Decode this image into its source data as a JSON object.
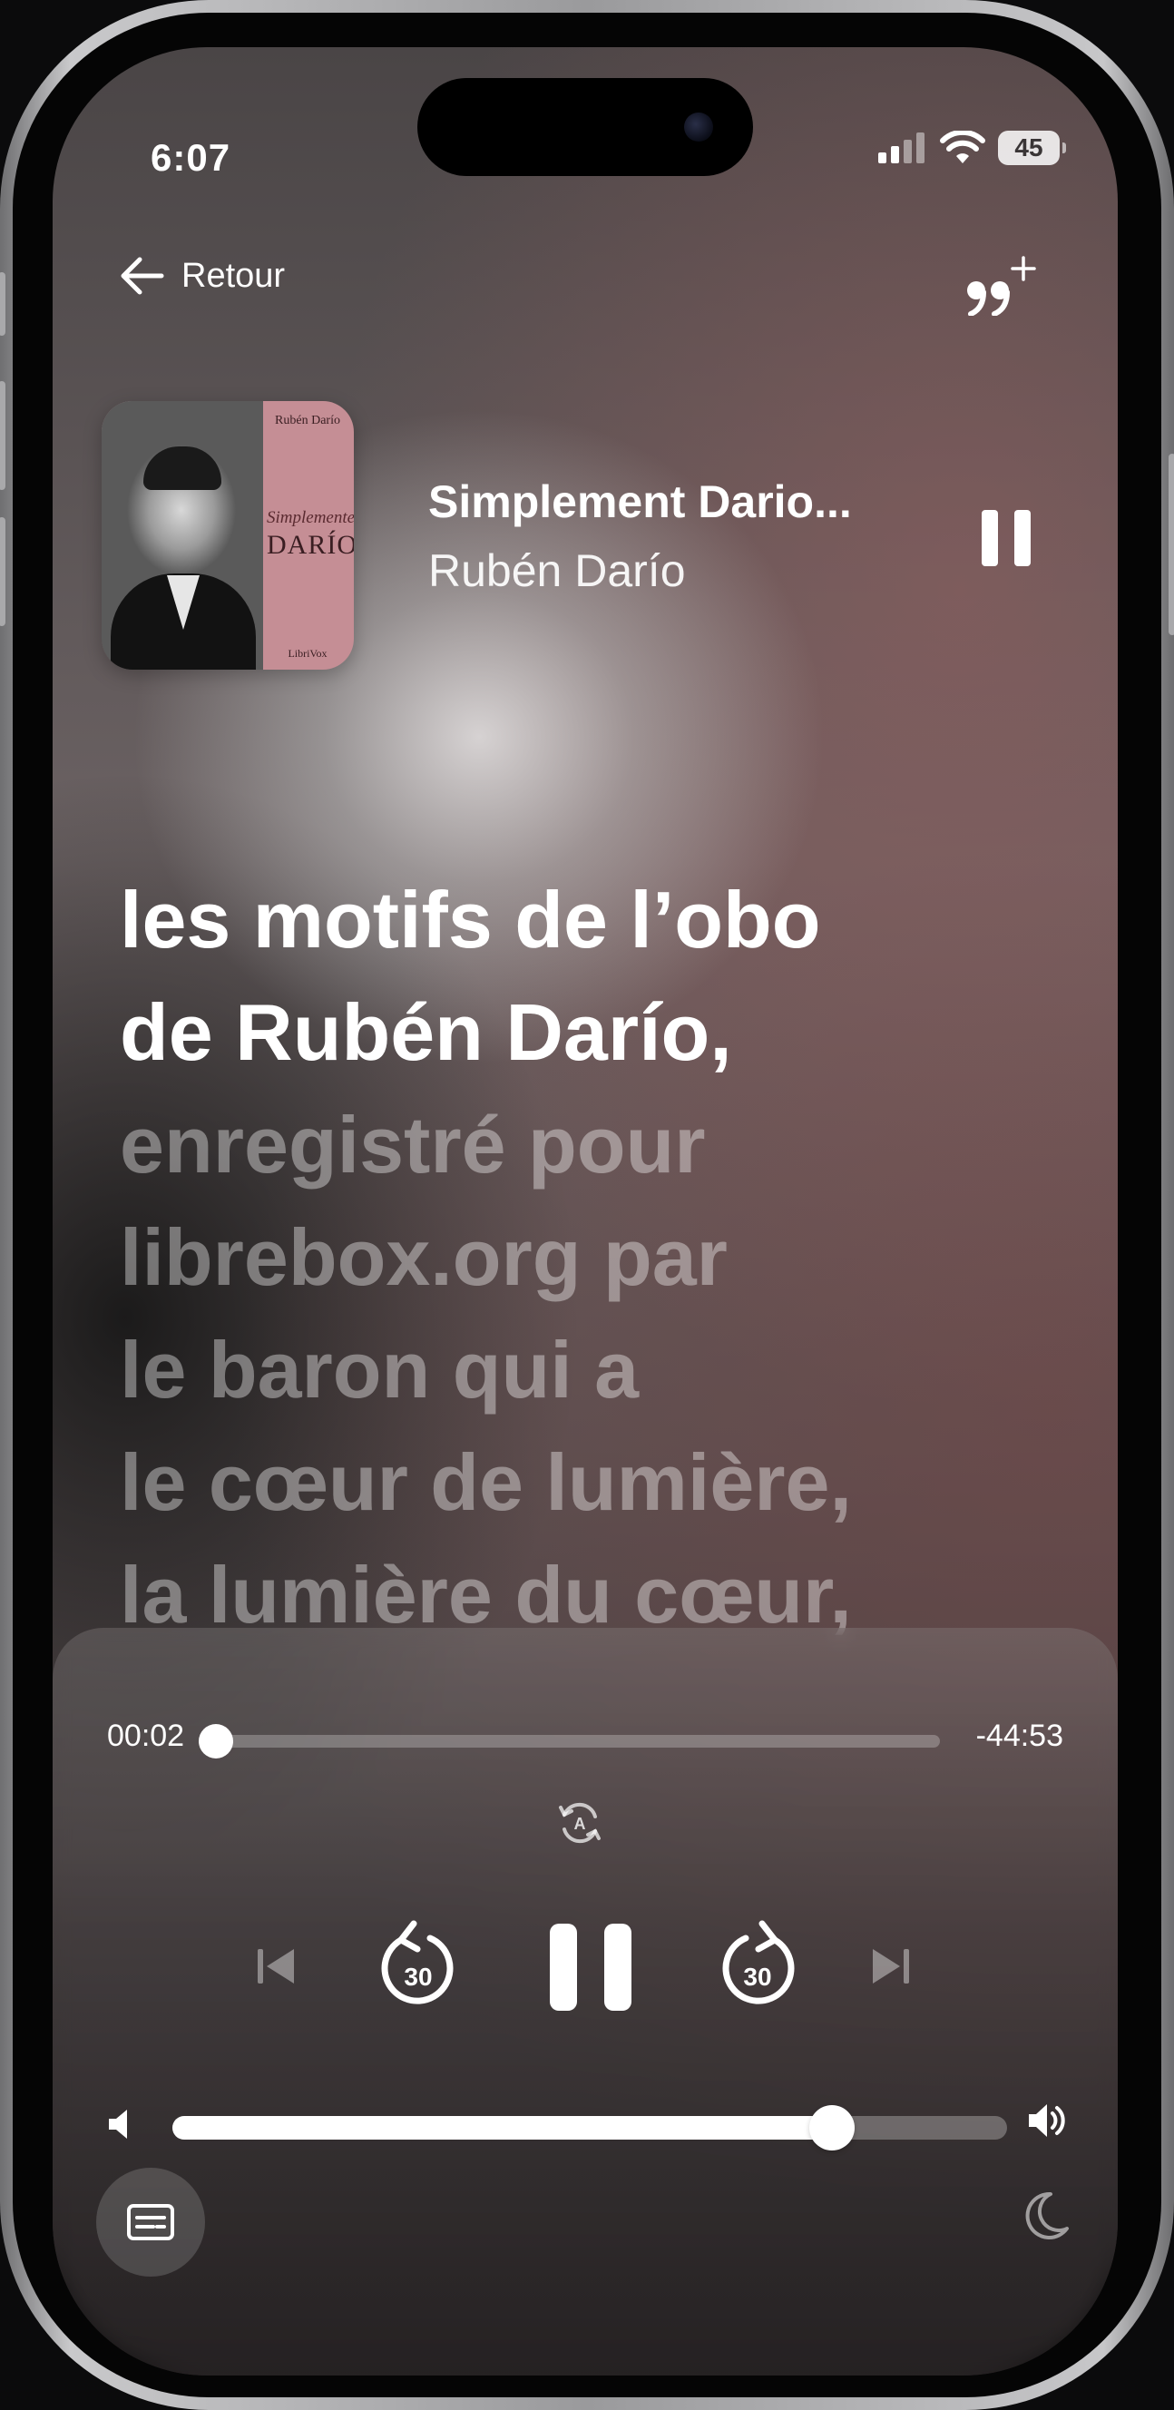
{
  "status_bar": {
    "time": "6:07",
    "battery": "45"
  },
  "nav": {
    "back_label": "Retour",
    "back_icon": "arrow-left-icon",
    "quote_icon": "add-quote-icon"
  },
  "cover": {
    "author": "Rubén Darío",
    "title_line1": "Simplemente",
    "title_line2": "DARÍO",
    "publisher": "LibriVox"
  },
  "now_playing": {
    "title": "Simplement Dario...",
    "author": "Rubén Darío"
  },
  "lyrics": [
    {
      "text": "les motifs de l’obo",
      "active": true
    },
    {
      "text": "de Rubén Darío,",
      "active": true
    },
    {
      "text": "enregistré pour",
      "active": false
    },
    {
      "text": "librebox.org par",
      "active": false
    },
    {
      "text": "le baron qui a",
      "active": false
    },
    {
      "text": "le cœur de lumière,",
      "active": false
    },
    {
      "text": "la lumière du cœur,",
      "active": false
    }
  ],
  "player": {
    "elapsed": "00:02",
    "remaining": "-44:53",
    "progress_fraction": 0.002,
    "skip_back_label": "30",
    "skip_forward_label": "30",
    "volume_fraction": 0.79
  },
  "colors": {
    "text": "#ffffff",
    "cover_background": "#c58e95"
  }
}
